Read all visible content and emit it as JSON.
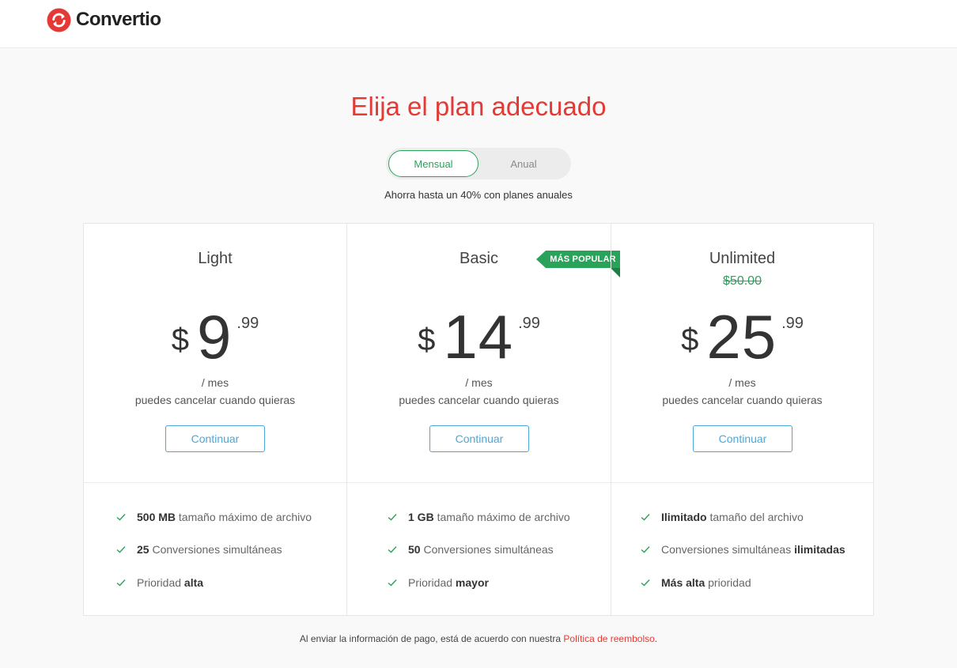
{
  "header": {
    "brand": "Convertio",
    "brand_color": "#e43a36"
  },
  "page": {
    "title": "Elija el plan adecuado",
    "billing_toggle": {
      "options": [
        "Mensual",
        "Anual"
      ],
      "selected": "Mensual"
    },
    "savings_note": "Ahorra hasta un 40% con planes anuales"
  },
  "plans": [
    {
      "name": "Light",
      "currency": "$",
      "price_int": "9",
      "price_dec": ".99",
      "period": "/ mes",
      "cancel_note": "puedes cancelar cuando quieras",
      "cta": "Continuar",
      "features": [
        {
          "bold": "500 MB",
          "text": " tamaño máximo de archivo",
          "order": "bold-first"
        },
        {
          "bold": "25",
          "text": " Conversiones simultáneas",
          "order": "bold-first"
        },
        {
          "bold": "alta",
          "text": "Prioridad ",
          "order": "text-first"
        }
      ]
    },
    {
      "name": "Basic",
      "badge": "MÁS POPULAR",
      "currency": "$",
      "price_int": "14",
      "price_dec": ".99",
      "period": "/ mes",
      "cancel_note": "puedes cancelar cuando quieras",
      "cta": "Continuar",
      "features": [
        {
          "bold": "1 GB",
          "text": " tamaño máximo de archivo",
          "order": "bold-first"
        },
        {
          "bold": "50",
          "text": " Conversiones simultáneas",
          "order": "bold-first"
        },
        {
          "bold": "mayor",
          "text": "Prioridad ",
          "order": "text-first"
        }
      ]
    },
    {
      "name": "Unlimited",
      "old_price": "$50.00",
      "currency": "$",
      "price_int": "25",
      "price_dec": ".99",
      "period": "/ mes",
      "cancel_note": "puedes cancelar cuando quieras",
      "cta": "Continuar",
      "features": [
        {
          "bold": "Ilimitado",
          "text": " tamaño del archivo",
          "order": "bold-first"
        },
        {
          "bold": "ilimitadas",
          "text": "Conversiones simultáneas ",
          "order": "text-first"
        },
        {
          "bold": "Más alta",
          "text": " prioridad",
          "order": "bold-first"
        }
      ]
    }
  ],
  "footer": {
    "text": "Al enviar la información de pago, está de acuerdo con nuestra ",
    "link": "Política de reembolso",
    "end": "."
  },
  "colors": {
    "accent_red": "#e43a36",
    "accent_green": "#2aa35a",
    "button_blue": "#4aa8d8"
  },
  "icons": {
    "logo": "convertio-arrows-icon",
    "feature_bullet": "check-icon"
  }
}
